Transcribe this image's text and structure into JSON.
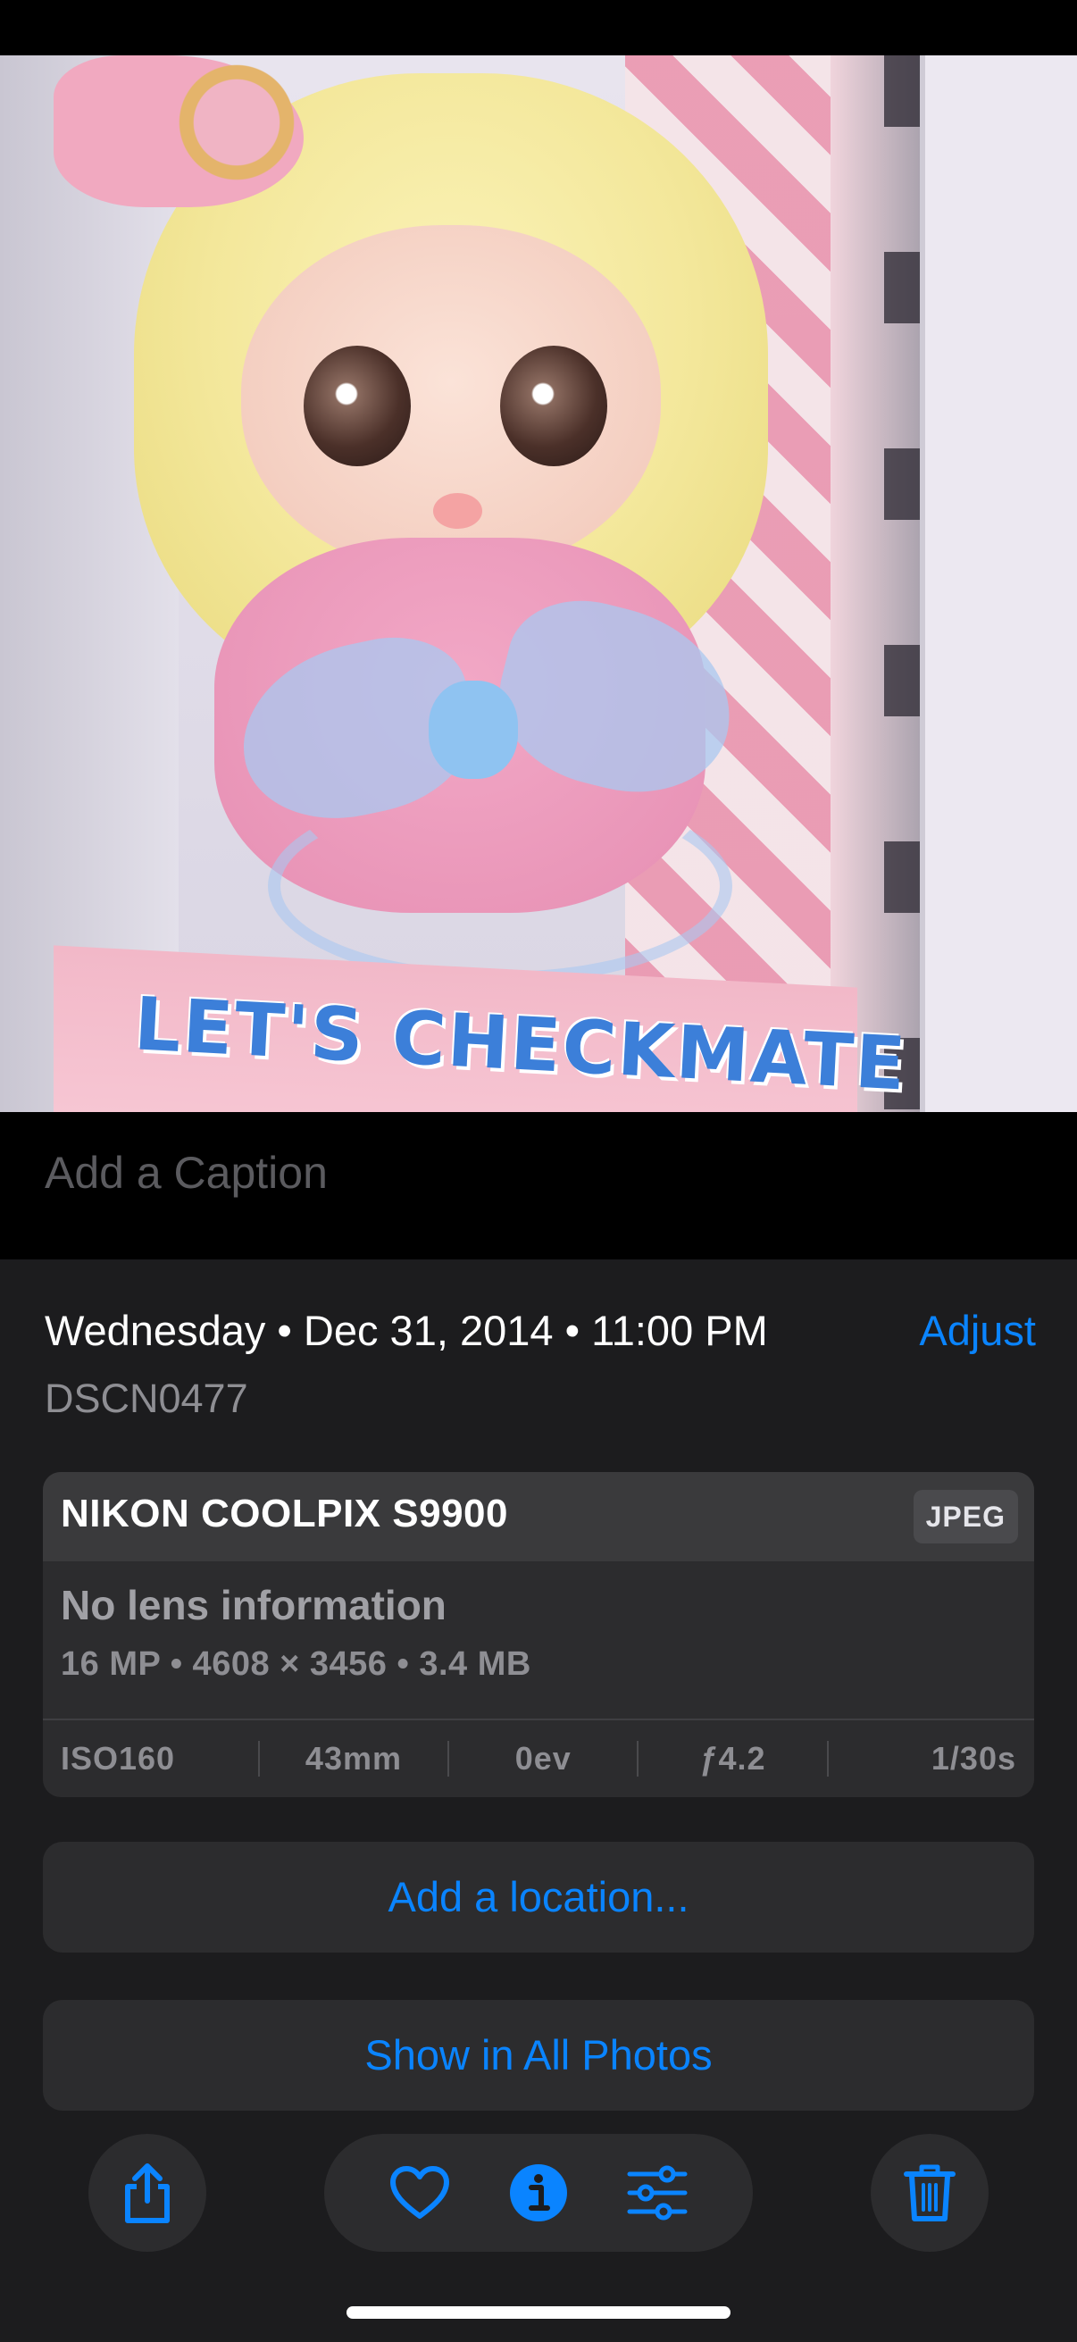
{
  "photo": {
    "subject": "plush doll in pink packaging",
    "printed_text": "LET'S CHECKMATE"
  },
  "caption": {
    "placeholder": "Add a Caption",
    "value": ""
  },
  "details": {
    "date_time": "Wednesday • Dec 31, 2014 • 11:00 PM",
    "adjust_label": "Adjust",
    "filename": "DSCN0477"
  },
  "camera": {
    "name": "NIKON COOLPIX S9900",
    "format": "JPEG",
    "lens": "No lens information",
    "specs": "16 MP • 4608 × 3456 • 3.4 MB",
    "exif": {
      "iso": "ISO160",
      "focal_length": "43mm",
      "exposure_bias": "0ev",
      "aperture": "ƒ4.2",
      "shutter": "1/30s"
    }
  },
  "actions": {
    "add_location": "Add a location...",
    "show_in_all_photos": "Show in All Photos"
  },
  "toolbar": {
    "share_icon": "share-icon",
    "favorite_icon": "heart-icon",
    "info_icon": "info-icon",
    "edit_icon": "sliders-icon",
    "delete_icon": "trash-icon"
  },
  "colors": {
    "accent": "#0a84ff",
    "panel": "#1c1c1e",
    "card": "#2c2c2e",
    "secondary_text": "#8e8e93"
  }
}
